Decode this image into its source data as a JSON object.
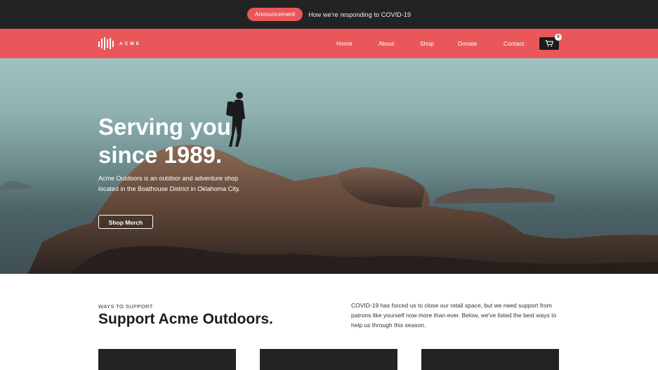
{
  "announcement": {
    "badge": "Announcement",
    "message": "How we're responding to COVID-19"
  },
  "nav": {
    "logo_text": "ACME",
    "links": [
      "Home",
      "About",
      "Shop",
      "Donate",
      "Contact"
    ],
    "cart_count": "0"
  },
  "hero": {
    "title_line1": "Serving you",
    "title_line2": "since 1989.",
    "description": "Acme Outdoors is an outdoor and adventure shop located in the Boathouse District in Oklahoma City.",
    "button": "Shop Merch"
  },
  "support": {
    "eyebrow": "WAYS TO SUPPORT",
    "title": "Support Acme Outdoors.",
    "text": "COVID-19 has forced us to close our retail space, but we need support from patrons like yourself now more than ever. Below, we've listed the best ways to help us through this season."
  },
  "colors": {
    "brand": "#e9575a",
    "dark": "#232323"
  },
  "icons": [
    "acme-logo-icon",
    "cart-icon"
  ]
}
